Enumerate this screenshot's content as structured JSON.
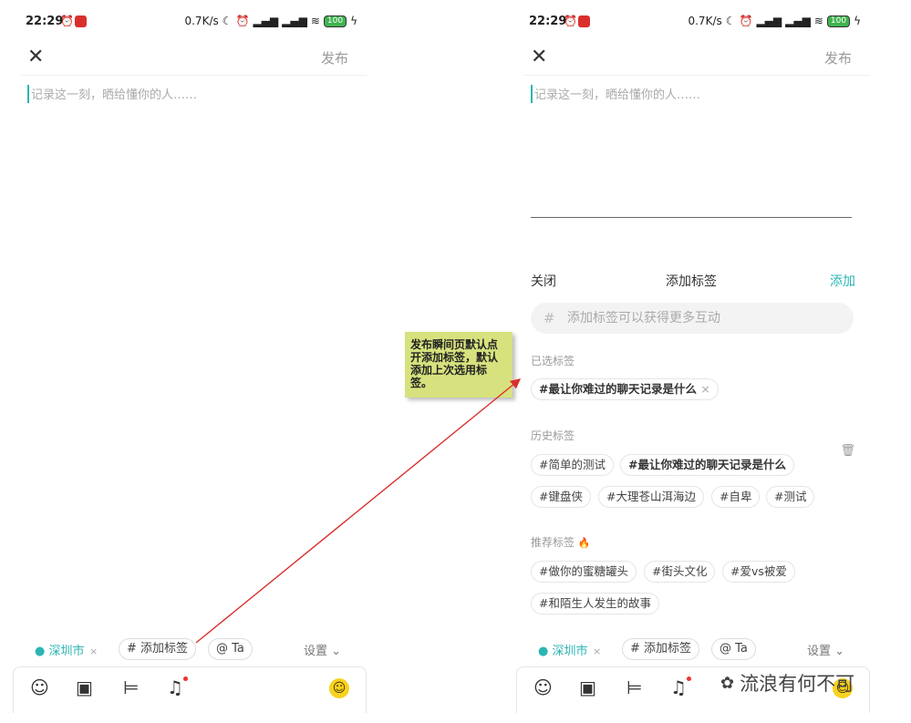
{
  "status": {
    "time": "22:29",
    "speed": "0.7K/s",
    "battery": "100"
  },
  "header": {
    "publish": "发布"
  },
  "editor": {
    "placeholder": "记录这一刻，晒给懂你的人……"
  },
  "tagbar": {
    "location": "深圳市",
    "add_tag": "添加标签",
    "mention": "Ta",
    "settings": "设置"
  },
  "panel": {
    "close": "关闭",
    "title": "添加标签",
    "add": "添加",
    "input_placeholder": "添加标签可以获得更多互动",
    "selected_label": "已选标签",
    "selected": [
      "#最让你难过的聊天记录是什么"
    ],
    "history_label": "历史标签",
    "history": [
      "#简单的测试",
      "#最让你难过的聊天记录是什么",
      "#键盘侠",
      "#大理苍山洱海边",
      "#自卑",
      "#测试"
    ],
    "recommend_label": "推荐标签",
    "recommend": [
      "#做你的蜜糖罐头",
      "#街头文化",
      "#爱vs被爱",
      "#和陌生人发生的故事"
    ]
  },
  "annotation": "发布瞬间页默认点开添加标签，默认添加上次选用标签。",
  "watermark": "流浪有何不可",
  "colors": {
    "accent": "#2bb5b5",
    "arrow": "#d9302c",
    "note_bg": "#d7e27e"
  }
}
